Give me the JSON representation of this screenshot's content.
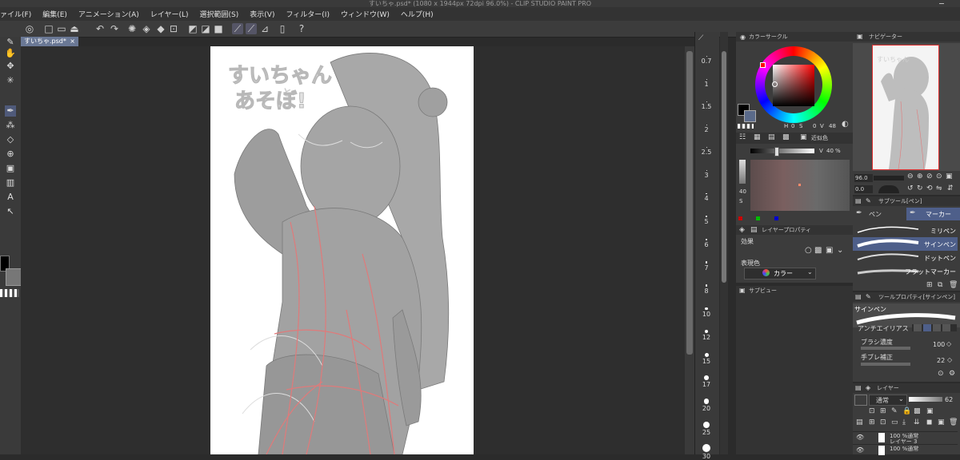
{
  "title": "すいちゃ.psd* (1080 x 1944px 72dpi 96.0%) - CLIP STUDIO PAINT PRO",
  "menu": [
    "ァイル(F)",
    "編集(E)",
    "アニメーション(A)",
    "レイヤー(L)",
    "選択範囲(S)",
    "表示(V)",
    "フィルター(I)",
    "ウィンドウ(W)",
    "ヘルプ(H)"
  ],
  "document": {
    "tab_label": "すいちゃ.psd*",
    "close_glyph": "×"
  },
  "canvas_art": {
    "text_line1": "すいちゃん",
    "text_line2": "と",
    "text_line3": "あそぼ!"
  },
  "brush_sizes": [
    "0.7",
    "1",
    "1.5",
    "2",
    "2.5",
    "3",
    "4",
    "5",
    "6",
    "7",
    "8",
    "10",
    "12",
    "15",
    "17",
    "20",
    "25",
    "30"
  ],
  "color_circle": {
    "title": "カラーサークル",
    "h_label": "H",
    "h_value": "0",
    "s_label": "S",
    "s_value": "0",
    "v_label": "V",
    "v_value": "48"
  },
  "color_slider": {
    "tab_label": "近似色",
    "v_label": "V",
    "v_value": "40",
    "unit": "%",
    "s_label": "S",
    "s_value": "40"
  },
  "layer_property": {
    "title": "レイヤープロパティ",
    "effect_label": "効果",
    "expression_label": "表現色",
    "expression_value": "カラー"
  },
  "subview": {
    "title": "サブビュー"
  },
  "navigator": {
    "title": "ナビゲーター",
    "zoom": "96.0",
    "rotate": "0.0"
  },
  "subtool": {
    "title": "サブツール[ペン]",
    "tabs": [
      "ペン",
      "マーカー"
    ],
    "brushes": [
      "ミリペン",
      "サインペン",
      "ドットペン",
      "フラットマーカー"
    ],
    "selected_index": 1
  },
  "tool_property": {
    "title": "ツールプロパティ[サインペン]",
    "brush_name": "サインペン",
    "anti_alias_label": "アンチエイリアス",
    "density_label": "ブラシ濃度",
    "density_value": "100",
    "stabilization_label": "手ブレ補正",
    "stabilization_value": "22"
  },
  "layers": {
    "title": "レイヤー",
    "blend_mode": "通常",
    "opacity": "62",
    "items": [
      {
        "line1": "100 %通常",
        "line2": "レイヤー 3"
      },
      {
        "line1": "100 %通常",
        "line2": ""
      }
    ]
  },
  "colors": {
    "accent": "#4e5f8a",
    "main_color": "#000000",
    "sub_color": "#777777"
  }
}
